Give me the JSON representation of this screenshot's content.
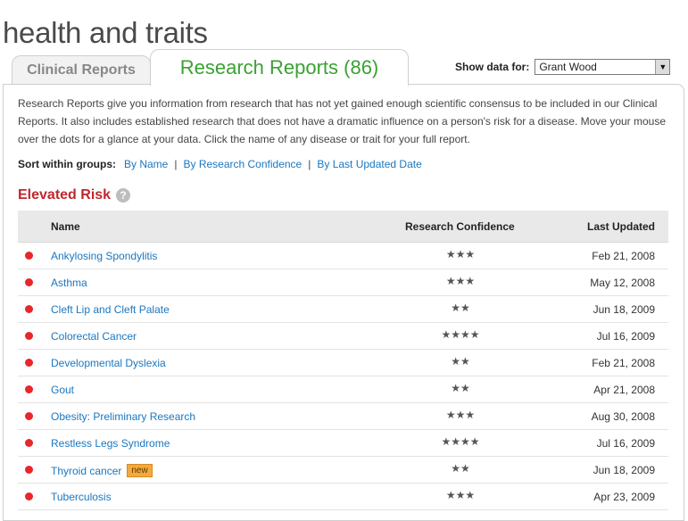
{
  "page": {
    "title": "health and traits"
  },
  "tabs": {
    "clinical": "Clinical Reports",
    "research": "Research Reports (86)"
  },
  "show_data": {
    "label": "Show data for:",
    "selected": "Grant Wood"
  },
  "intro": "Research Reports give you information from research that has not yet gained enough scientific consensus to be included in our Clinical Reports. It also includes established research that does not have a dramatic influence on a person's risk for a disease. Move your mouse over the dots for a glance at your data. Click the name of any disease or trait for your full report.",
  "sort": {
    "label": "Sort within groups:",
    "by_name": "By Name",
    "by_confidence": "By Research Confidence",
    "by_date": "By Last Updated Date",
    "separator": "|"
  },
  "section": {
    "title": "Elevated Risk",
    "help": "?"
  },
  "table": {
    "headers": {
      "name": "Name",
      "confidence": "Research Confidence",
      "updated": "Last Updated"
    },
    "rows": [
      {
        "name": "Ankylosing Spondylitis",
        "stars": "★★★",
        "date": "Feb 21, 2008",
        "badge": ""
      },
      {
        "name": "Asthma",
        "stars": "★★★",
        "date": "May 12, 2008",
        "badge": ""
      },
      {
        "name": "Cleft Lip and Cleft Palate",
        "stars": "★★",
        "date": "Jun 18, 2009",
        "badge": ""
      },
      {
        "name": "Colorectal Cancer",
        "stars": "★★★★",
        "date": "Jul 16, 2009",
        "badge": ""
      },
      {
        "name": "Developmental Dyslexia",
        "stars": "★★",
        "date": "Feb 21, 2008",
        "badge": ""
      },
      {
        "name": "Gout",
        "stars": "★★",
        "date": "Apr 21, 2008",
        "badge": ""
      },
      {
        "name": "Obesity: Preliminary Research",
        "stars": "★★★",
        "date": "Aug 30, 2008",
        "badge": ""
      },
      {
        "name": "Restless Legs Syndrome",
        "stars": "★★★★",
        "date": "Jul 16, 2009",
        "badge": ""
      },
      {
        "name": "Thyroid cancer",
        "stars": "★★",
        "date": "Jun 18, 2009",
        "badge": "new"
      },
      {
        "name": "Tuberculosis",
        "stars": "★★★",
        "date": "Apr 23, 2009",
        "badge": ""
      }
    ]
  },
  "colors": {
    "risk_dot": "#e8262b",
    "link": "#1a77c0",
    "tab_active": "#3aa132",
    "section_title": "#c0272d"
  }
}
